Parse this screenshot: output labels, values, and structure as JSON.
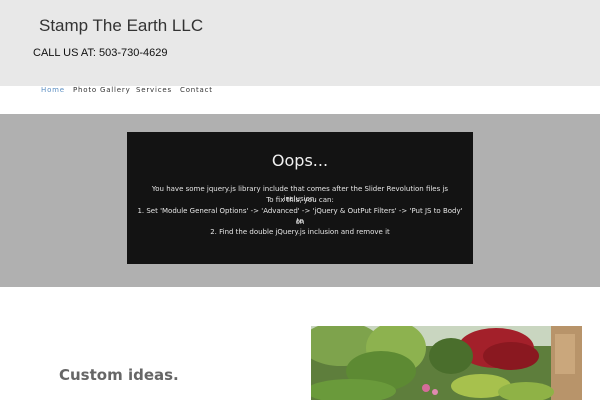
{
  "site": {
    "title": "Stamp The Earth LLC",
    "call_us": "CALL US AT: 503-730-4629"
  },
  "nav": {
    "items": [
      {
        "label": "Home",
        "active": true
      },
      {
        "label": "Photo Gallery",
        "active": false
      },
      {
        "label": "Services",
        "active": false
      },
      {
        "label": "Contact",
        "active": false
      }
    ]
  },
  "slider_error": {
    "title": "Oops...",
    "lines": [
      "You have some jquery.js library include that comes after the Slider Revolution files js inclusion.",
      "To fix this, you can:",
      "1. Set 'Module General Options' -> 'Advanced' -> 'jQuery & OutPut Filters' -> 'Put JS to Body' to",
      "on",
      "2. Find the double jQuery.js inclusion and remove it"
    ]
  },
  "content": {
    "heading": "Custom ideas."
  },
  "colors": {
    "header_bg": "#e8e8e8",
    "nav_active": "#5c8fc2",
    "slider_band": "#b0b0b0",
    "error_box": "#131313"
  }
}
